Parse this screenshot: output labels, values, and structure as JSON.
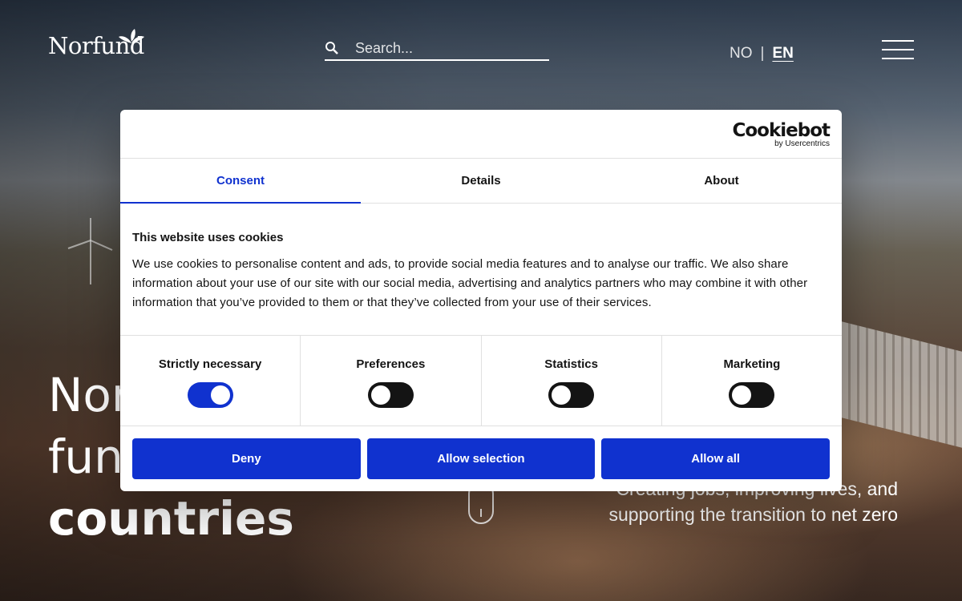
{
  "header": {
    "logo_text": "Norfund",
    "search": {
      "placeholder": "Search..."
    },
    "language": {
      "no": "NO",
      "separator": "|",
      "en": "EN",
      "active": "EN"
    }
  },
  "hero": {
    "title_line1": "Nor",
    "title_line2": "func",
    "title_line3": "countries",
    "subtitle_line1": "Creating jobs, improving lives, and",
    "subtitle_line2": "supporting the transition to net zero"
  },
  "cookie_dialog": {
    "brand": "Cookiebot",
    "brand_sub": "by Usercentrics",
    "tabs": [
      {
        "label": "Consent",
        "active": true
      },
      {
        "label": "Details",
        "active": false
      },
      {
        "label": "About",
        "active": false
      }
    ],
    "heading": "This website uses cookies",
    "body": "We use cookies to personalise content and ads, to provide social media features and to analyse our traffic. We also share information about your use of our site with our social media, advertising and analytics partners who may combine it with other information that you’ve provided to them or that they’ve collected from your use of their services.",
    "categories": [
      {
        "label": "Strictly necessary",
        "enabled": true
      },
      {
        "label": "Preferences",
        "enabled": false
      },
      {
        "label": "Statistics",
        "enabled": false
      },
      {
        "label": "Marketing",
        "enabled": false
      }
    ],
    "buttons": {
      "deny": "Deny",
      "allow_selection": "Allow selection",
      "allow_all": "Allow all"
    },
    "accent_color": "#1032cf"
  }
}
